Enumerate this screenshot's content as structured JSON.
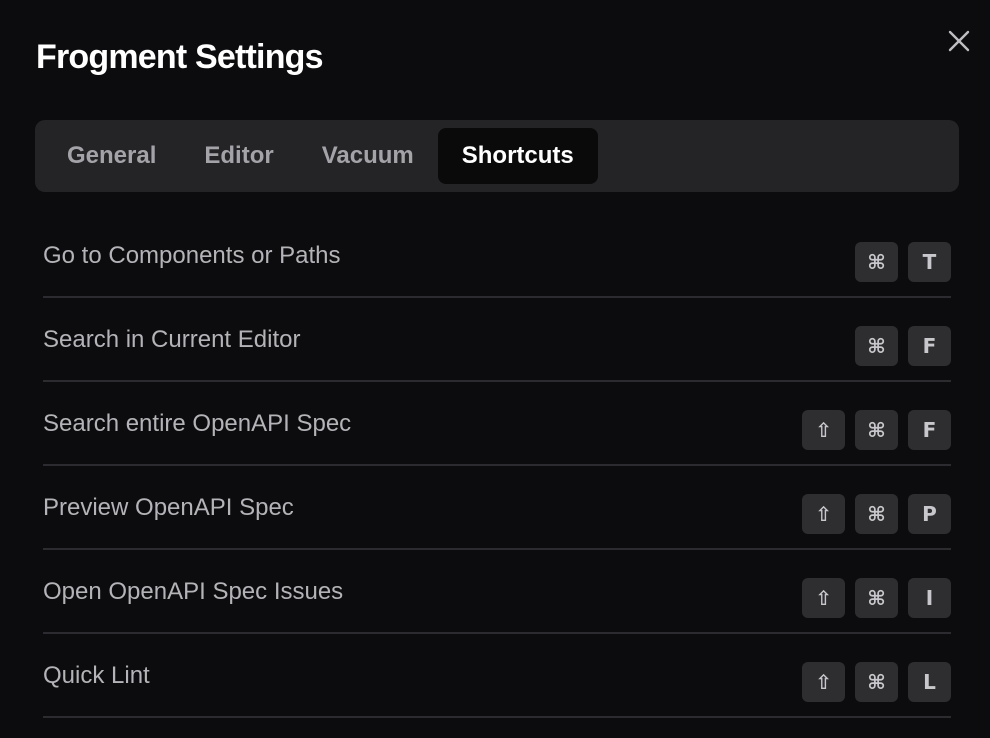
{
  "dialog": {
    "title": "Frogment Settings",
    "close_icon": "close-icon"
  },
  "tabs": [
    {
      "label": "General",
      "active": false
    },
    {
      "label": "Editor",
      "active": false
    },
    {
      "label": "Vacuum",
      "active": false
    },
    {
      "label": "Shortcuts",
      "active": true
    }
  ],
  "shortcuts": [
    {
      "label": "Go to Components or Paths",
      "keys": [
        "⌘",
        "T"
      ]
    },
    {
      "label": "Search in Current Editor",
      "keys": [
        "⌘",
        "F"
      ]
    },
    {
      "label": "Search entire OpenAPI Spec",
      "keys": [
        "⇧",
        "⌘",
        "F"
      ]
    },
    {
      "label": "Preview OpenAPI Spec",
      "keys": [
        "⇧",
        "⌘",
        "P"
      ]
    },
    {
      "label": "Open OpenAPI Spec Issues",
      "keys": [
        "⇧",
        "⌘",
        "I"
      ]
    },
    {
      "label": "Quick Lint",
      "keys": [
        "⇧",
        "⌘",
        "L"
      ]
    }
  ],
  "colors": {
    "background": "#0c0c0e",
    "tabbar": "#242427",
    "active_tab": "#0a0a0b",
    "key_bg": "#2e2e31"
  }
}
